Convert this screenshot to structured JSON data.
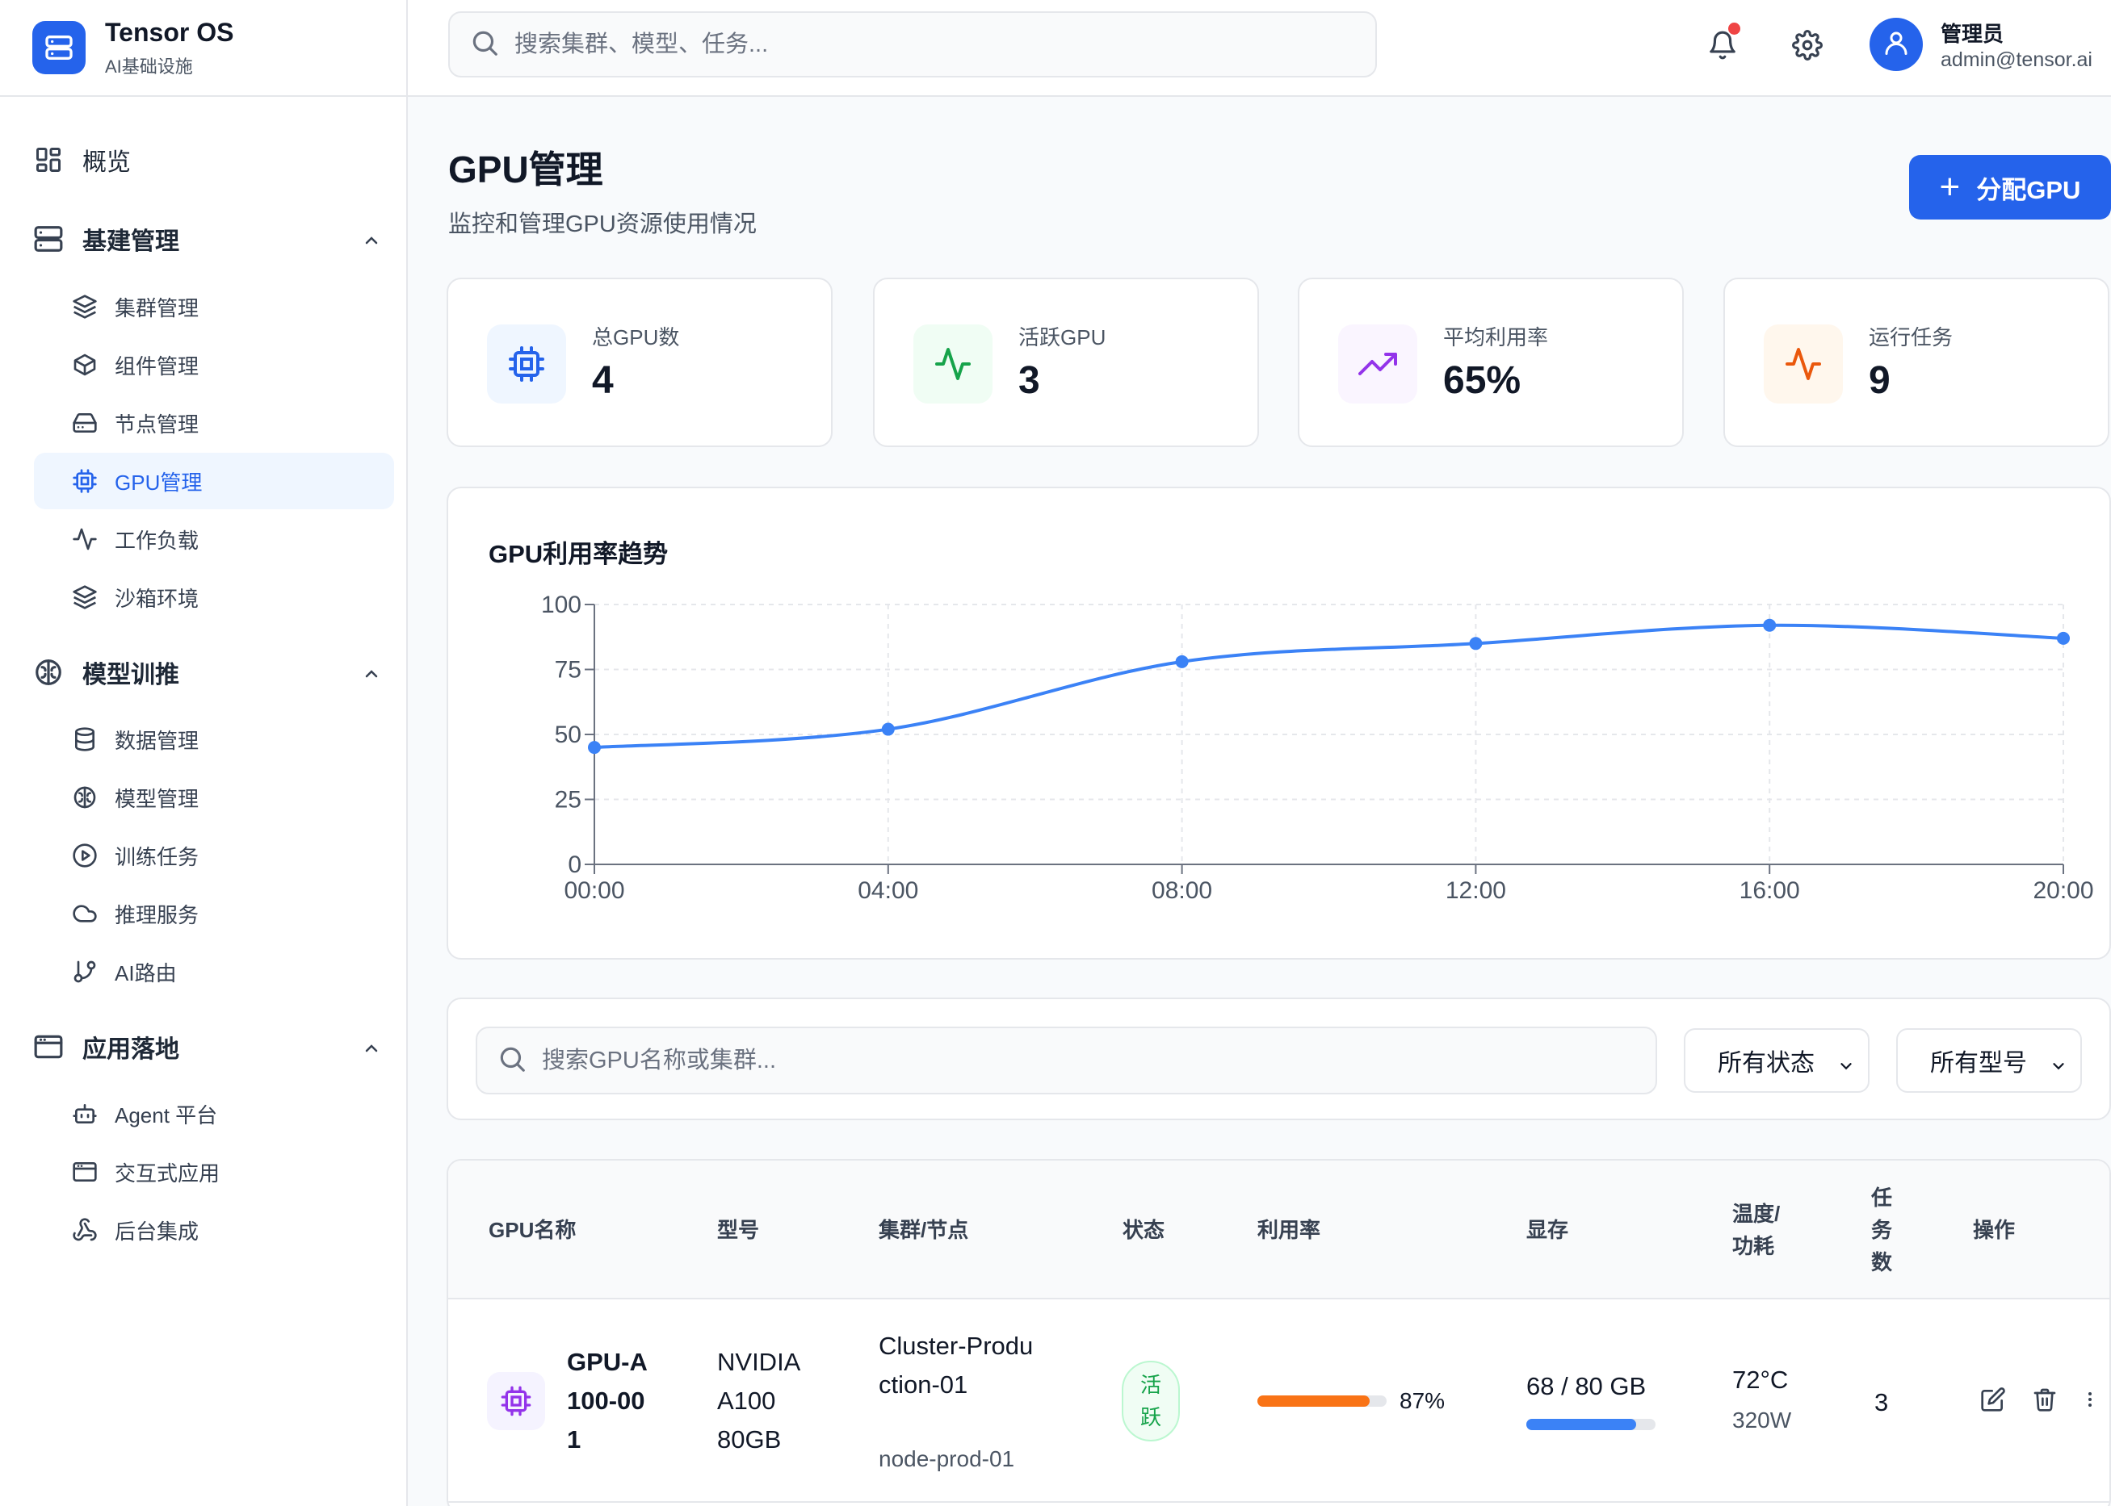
{
  "brand": {
    "title": "Tensor OS",
    "subtitle": "AI基础设施"
  },
  "topbar": {
    "search_placeholder": "搜索集群、模型、任务...",
    "user_name": "管理员",
    "user_email": "admin@tensor.ai",
    "has_notification": true
  },
  "sidebar": {
    "overview": "概览",
    "sections": [
      {
        "label": "基建管理",
        "items": [
          "集群管理",
          "组件管理",
          "节点管理",
          "GPU管理",
          "工作负载",
          "沙箱环境"
        ]
      },
      {
        "label": "模型训推",
        "items": [
          "数据管理",
          "模型管理",
          "训练任务",
          "推理服务",
          "AI路由"
        ]
      },
      {
        "label": "应用落地",
        "items": [
          "Agent 平台",
          "交互式应用",
          "后台集成"
        ]
      }
    ],
    "active_item": "GPU管理"
  },
  "page": {
    "title": "GPU管理",
    "subtitle": "监控和管理GPU资源使用情况",
    "primary_button": "分配GPU"
  },
  "stats": [
    {
      "label": "总GPU数",
      "value": "4",
      "icon": "cpu-chip-icon",
      "color": "#2563eb",
      "bg": "#eff6ff"
    },
    {
      "label": "活跃GPU",
      "value": "3",
      "icon": "activity-icon",
      "color": "#16a34a",
      "bg": "#f0fdf4"
    },
    {
      "label": "平均利用率",
      "value": "65%",
      "icon": "trending-up-icon",
      "color": "#9333ea",
      "bg": "#faf5ff"
    },
    {
      "label": "运行任务",
      "value": "9",
      "icon": "activity-icon",
      "color": "#ea580c",
      "bg": "#fff7ed"
    }
  ],
  "chart_data": {
    "type": "line",
    "title": "GPU利用率趋势",
    "x": [
      "00:00",
      "04:00",
      "08:00",
      "12:00",
      "16:00",
      "20:00"
    ],
    "series": [
      {
        "values": [
          45,
          52,
          78,
          85,
          92,
          87
        ],
        "color": "#3b82f6"
      }
    ],
    "ylim": [
      0,
      100
    ],
    "yticks": [
      0,
      25,
      50,
      75,
      100
    ],
    "grid": true
  },
  "filters": {
    "search_placeholder": "搜索GPU名称或集群...",
    "status_select": "所有状态",
    "model_select": "所有型号"
  },
  "table": {
    "headers": {
      "name": "GPU名称",
      "model": "型号",
      "cluster": "集群/节点",
      "status": "状态",
      "util": "利用率",
      "memory": "显存",
      "temp_power": "温度/功耗",
      "tasks": "任务数",
      "actions": "操作"
    },
    "rows": [
      {
        "name": "GPU-A100-001",
        "model": "NVIDIA A100 80GB",
        "cluster": "Cluster-Production-01",
        "node": "node-prod-01",
        "status": "活跃",
        "utilization": 87,
        "utilization_label": "87%",
        "memory_used": 68,
        "memory_total": 80,
        "memory_label": "68 / 80 GB",
        "temperature": "72°C",
        "power": "320W",
        "tasks": "3"
      }
    ]
  }
}
